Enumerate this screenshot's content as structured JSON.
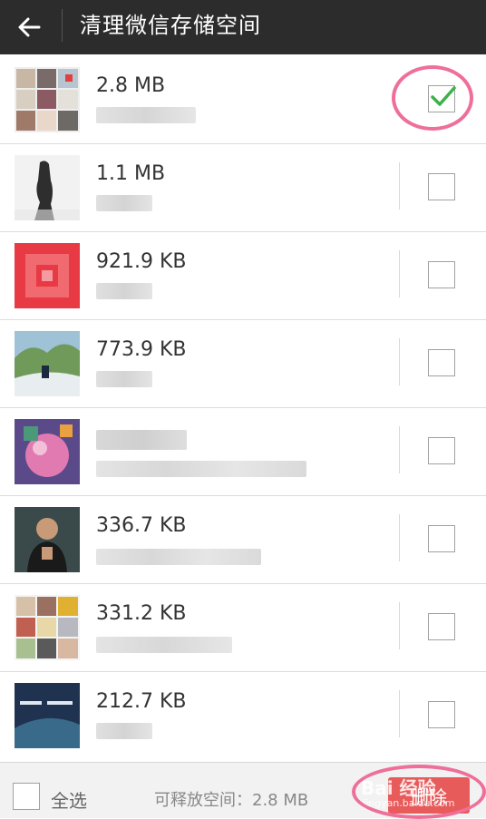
{
  "header": {
    "title": "清理微信存储空间",
    "back_icon": "back-arrow-icon"
  },
  "items": [
    {
      "size": "2.8 MB",
      "checked": true
    },
    {
      "size": "1.1 MB",
      "checked": false
    },
    {
      "size": "921.9 KB",
      "checked": false
    },
    {
      "size": "773.9 KB",
      "checked": false
    },
    {
      "size": "",
      "checked": false
    },
    {
      "size": "336.7 KB",
      "checked": false
    },
    {
      "size": "331.2 KB",
      "checked": false
    },
    {
      "size": "212.7 KB",
      "checked": false
    }
  ],
  "footer": {
    "select_all_label": "全选",
    "free_space_text": "可释放空间：2.8 MB",
    "delete_label": "删除",
    "watermark_main": "Bai 经验",
    "watermark_sub": "jingyan.baidu.com"
  },
  "colors": {
    "topbar": "#2c2c2c",
    "accent_check": "#3cb24a",
    "delete_button": "#e85b5b",
    "highlight_circle": "#ee6f98"
  }
}
